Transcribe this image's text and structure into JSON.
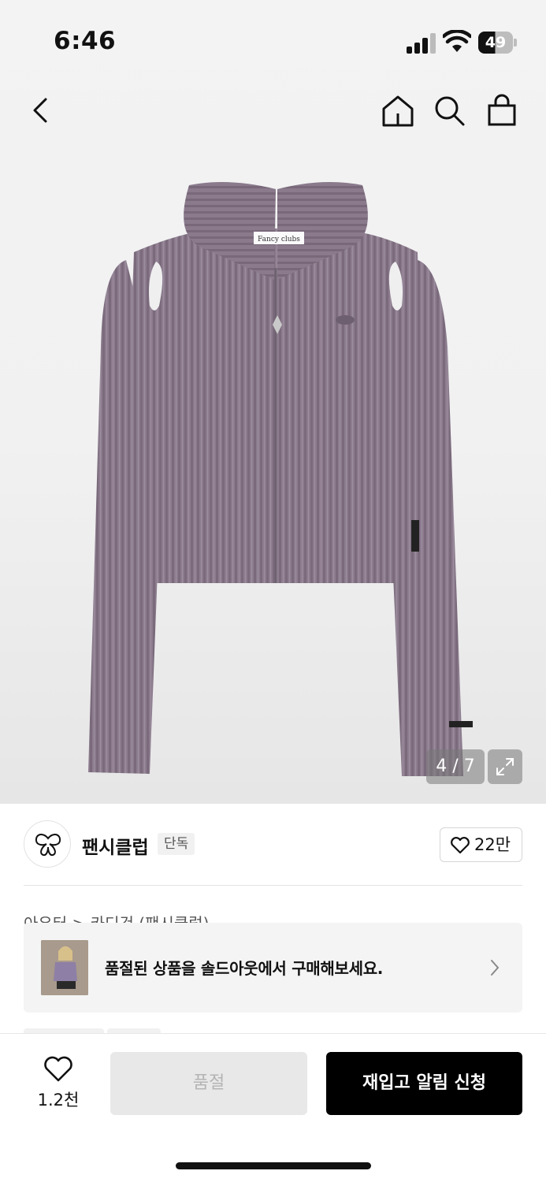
{
  "status_bar": {
    "time": "6:46",
    "battery": "49"
  },
  "nav": {
    "back_icon": "chevron-left-icon",
    "home_icon": "home-icon",
    "search_icon": "search-icon",
    "bag_icon": "shopping-bag-icon"
  },
  "product_image": {
    "label_text": "Fancy clubs",
    "counter": "4 / 7",
    "expand_icon": "expand-icon"
  },
  "brand": {
    "name": "팬시클럽",
    "badge": "단독",
    "like_count": "22만"
  },
  "breadcrumb": "아우터 > 카디건 (팬시클럽)",
  "soldout_banner": {
    "text": "품절된 상품을 솔드아웃에서 구매해보세요."
  },
  "bottom_bar": {
    "wish_count": "1.2천",
    "soldout_label": "품절",
    "restock_label": "재입고 알림 신청"
  },
  "colors": {
    "accent": "#000000",
    "sweater": "#8a7a8c",
    "disabled_bg": "#e8e8e8"
  }
}
